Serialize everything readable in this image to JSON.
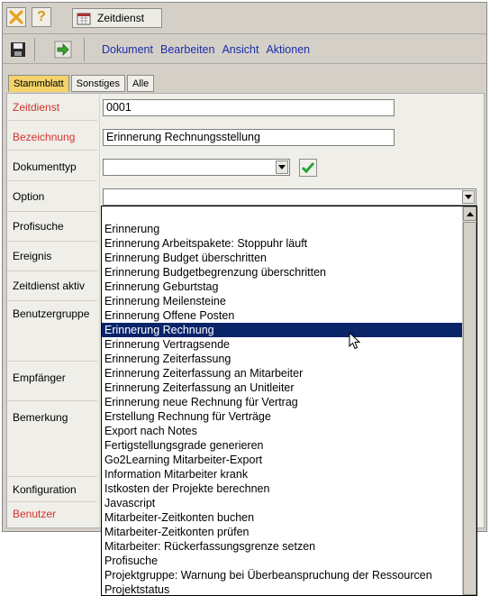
{
  "topbar": {
    "close_icon": "close-icon",
    "help_icon": "help-icon",
    "tab_label": "Zeitdienst"
  },
  "toolbar": {
    "menu": [
      "Dokument",
      "Bearbeiten",
      "Ansicht",
      "Aktionen"
    ]
  },
  "tabs": [
    "Stammblatt",
    "Sonstiges",
    "Alle"
  ],
  "form": {
    "labels": {
      "zeitdienst": "Zeitdienst",
      "bezeichnung": "Bezeichnung",
      "dokumenttyp": "Dokumenttyp",
      "option": "Option",
      "profisuche": "Profisuche",
      "ereignis": "Ereignis",
      "zeitdienst_aktiv": "Zeitdienst aktiv",
      "benutzergruppe": "Benutzergruppe",
      "empfaenger": "Empfänger",
      "bemerkung": "Bemerkung",
      "konfiguration": "Konfiguration",
      "benutzer": "Benutzer"
    },
    "values": {
      "zeitdienst": "0001",
      "bezeichnung": "Erinnerung Rechnungsstellung",
      "dokumenttyp": "",
      "option": ""
    }
  },
  "dropdown": {
    "items": [
      "Erinnerung",
      "Erinnerung Arbeitspakete: Stoppuhr läuft",
      "Erinnerung Budget überschritten",
      "Erinnerung Budgetbegrenzung überschritten",
      "Erinnerung Geburtstag",
      "Erinnerung Meilensteine",
      "Erinnerung Offene Posten",
      "Erinnerung Rechnung",
      "Erinnerung Vertragsende",
      "Erinnerung Zeiterfassung",
      "Erinnerung Zeiterfassung an Mitarbeiter",
      "Erinnerung Zeiterfassung an Unitleiter",
      "Erinnerung neue Rechnung für Vertrag",
      "Erstellung Rechnung für Verträge",
      "Export nach Notes",
      "Fertigstellungsgrade generieren",
      "Go2Learning Mitarbeiter-Export",
      "Information Mitarbeiter krank",
      "Istkosten der Projekte berechnen",
      "Javascript",
      "Mitarbeiter-Zeitkonten buchen",
      "Mitarbeiter-Zeitkonten prüfen",
      "Mitarbeiter: Rückerfassungsgrenze setzen",
      "Profisuche",
      "Projektgruppe: Warnung bei Überbeanspruchung der Ressourcen",
      "Projektstatus"
    ],
    "selected_index": 7
  },
  "colors": {
    "accent_tab": "#f3d36a",
    "required_label": "#d2322d",
    "menu_link": "#1b2ca8",
    "selection": "#0a246a"
  }
}
